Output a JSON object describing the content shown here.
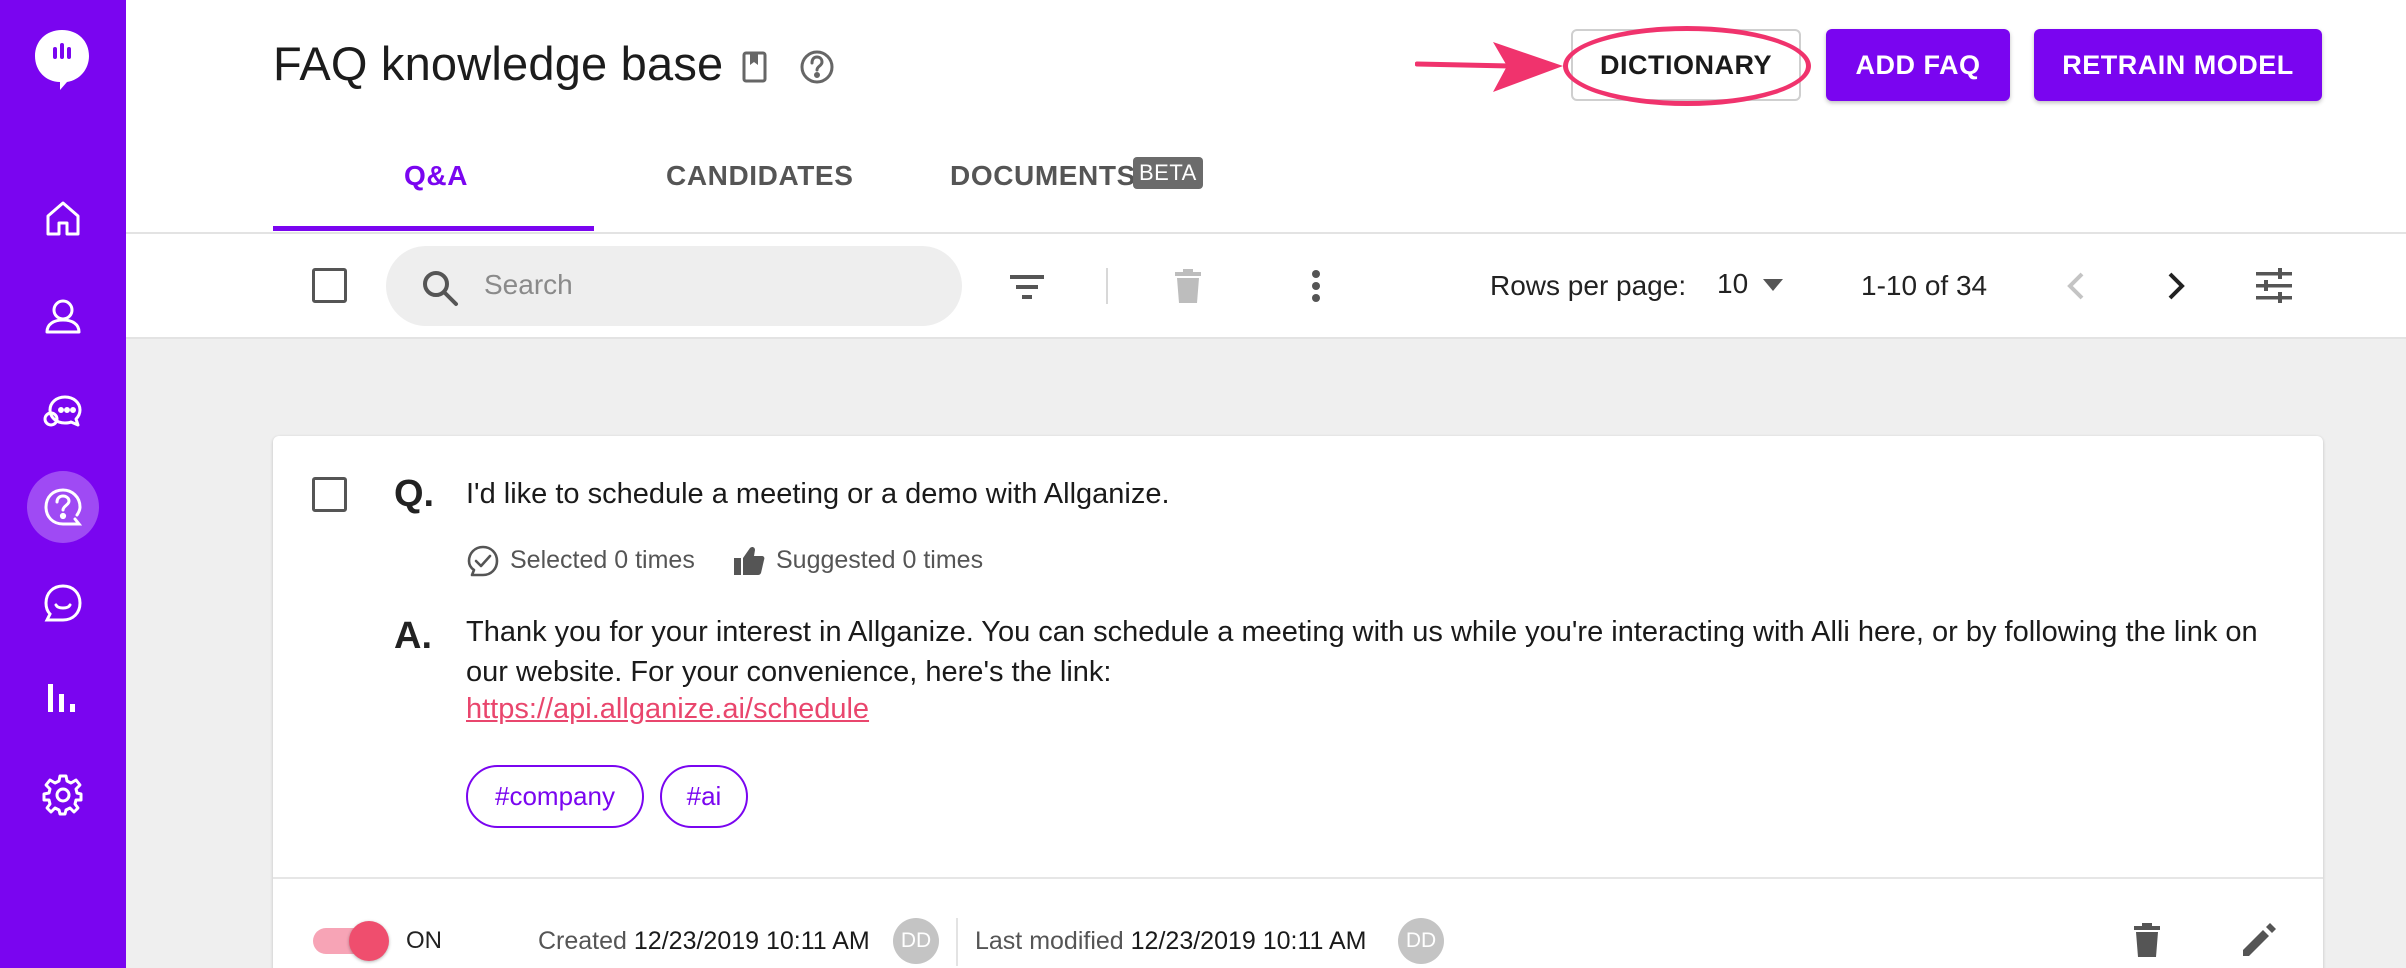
{
  "header": {
    "title": "FAQ knowledge base",
    "buttons": {
      "dictionary": "DICTIONARY",
      "add_faq": "ADD FAQ",
      "retrain_model": "RETRAIN MODEL"
    }
  },
  "tabs": [
    {
      "label": "Q&A",
      "active": true
    },
    {
      "label": "CANDIDATES",
      "active": false
    },
    {
      "label": "DOCUMENTS",
      "badge": "BETA",
      "active": false
    }
  ],
  "toolbar": {
    "search_placeholder": "Search",
    "rows_per_page_label": "Rows per page:",
    "rows_per_page_value": "10",
    "page_range": "1-10 of 34"
  },
  "sidebar": {
    "items": [
      {
        "icon": "home-icon"
      },
      {
        "icon": "user-icon"
      },
      {
        "icon": "chat-bubbles-icon"
      },
      {
        "icon": "faq-icon",
        "active": true
      },
      {
        "icon": "conversation-icon"
      },
      {
        "icon": "analytics-icon"
      },
      {
        "icon": "settings-icon"
      }
    ]
  },
  "faq_item": {
    "q_marker": "Q.",
    "question": "I'd like to schedule a meeting or a demo with Allganize.",
    "selected": "Selected 0 times",
    "suggested": "Suggested 0 times",
    "a_marker": "A.",
    "answer": "Thank you for your interest in Allganize. You can schedule a meeting with us while you're interacting with Alli here, or by following the link on our website. For your convenience, here's the link:",
    "link": "https://api.allganize.ai/schedule",
    "tags": [
      "#company",
      "#ai"
    ],
    "status": "ON",
    "created_label": "Created",
    "created_at": "12/23/2019 10:11 AM",
    "created_by": "DD",
    "modified_label": "Last modified",
    "modified_at": "12/23/2019 10:11 AM",
    "modified_by": "DD"
  },
  "colors": {
    "brand": "#7a05f0",
    "accent": "#f0336d",
    "link": "#e9466d"
  }
}
